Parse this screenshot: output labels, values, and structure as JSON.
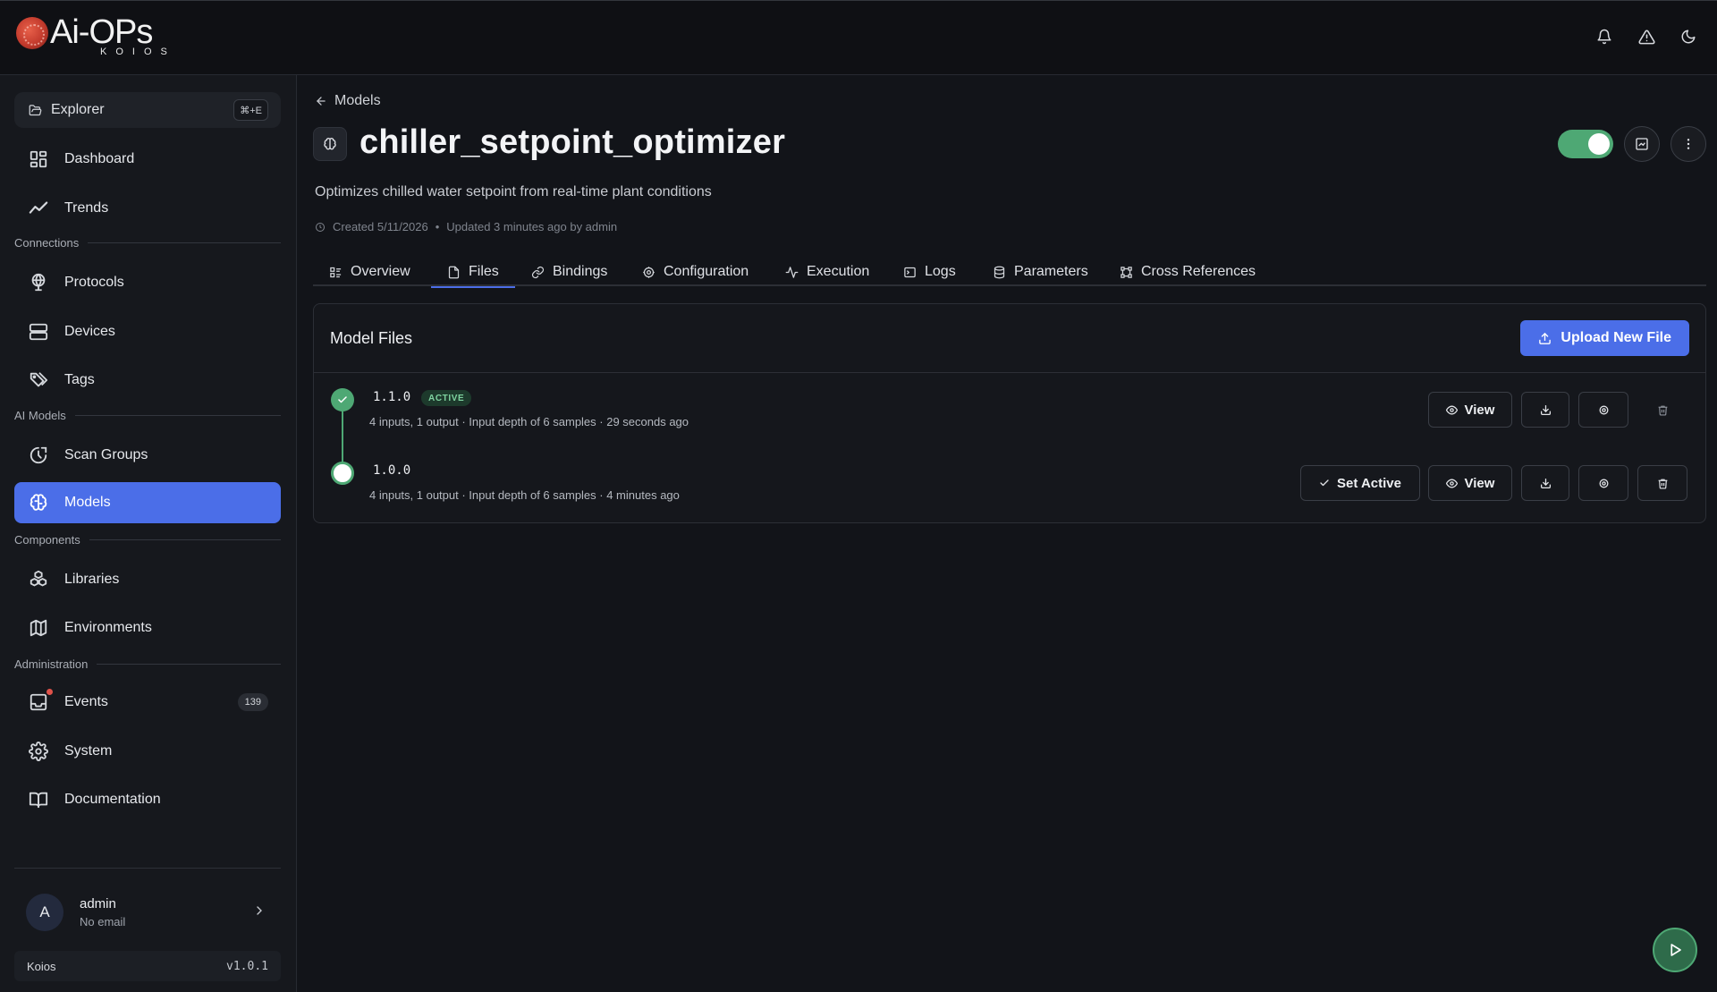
{
  "app": {
    "logo_main": "Ai-OPs",
    "logo_sub": "KOIOS"
  },
  "header": {
    "icons": [
      "bell-icon",
      "alert-triangle-icon",
      "moon-icon"
    ]
  },
  "sidebar": {
    "explorer": {
      "label": "Explorer",
      "shortcut": "⌘+E"
    },
    "items": [
      {
        "label": "Dashboard",
        "icon": "dashboard-icon"
      },
      {
        "label": "Trends",
        "icon": "trends-icon"
      },
      {
        "label": "Protocols",
        "icon": "protocols-icon"
      },
      {
        "label": "Devices",
        "icon": "devices-icon"
      },
      {
        "label": "Tags",
        "icon": "tags-icon"
      },
      {
        "label": "Scan Groups",
        "icon": "scan-groups-icon"
      },
      {
        "label": "Models",
        "icon": "brain-icon",
        "active": true
      },
      {
        "label": "Libraries",
        "icon": "libraries-icon"
      },
      {
        "label": "Environments",
        "icon": "map-icon"
      },
      {
        "label": "Events",
        "icon": "inbox-icon",
        "count": "139"
      },
      {
        "label": "System",
        "icon": "gear-icon"
      },
      {
        "label": "Documentation",
        "icon": "book-icon"
      }
    ],
    "sections": {
      "connections": "Connections",
      "ai_models": "AI Models",
      "components": "Components",
      "administration": "Administration"
    },
    "user": {
      "initial": "A",
      "name": "admin",
      "email": "No email"
    },
    "footer": {
      "name": "Koios",
      "version": "v1.0.1"
    }
  },
  "page": {
    "breadcrumb": "Models",
    "title": "chiller_setpoint_optimizer",
    "description": "Optimizes chilled water setpoint from real-time plant conditions",
    "created": "Created 5/11/2026",
    "separator": "•",
    "updated": "Updated 3 minutes ago by admin",
    "enabled": true,
    "tabs": [
      {
        "label": "Overview",
        "icon": "overview-icon"
      },
      {
        "label": "Files",
        "icon": "file-icon",
        "active": true
      },
      {
        "label": "Bindings",
        "icon": "link-icon"
      },
      {
        "label": "Configuration",
        "icon": "gear-icon"
      },
      {
        "label": "Execution",
        "icon": "activity-icon"
      },
      {
        "label": "Logs",
        "icon": "terminal-icon"
      },
      {
        "label": "Parameters",
        "icon": "database-icon"
      },
      {
        "label": "Cross References",
        "icon": "cross-references-icon"
      }
    ]
  },
  "files": {
    "title": "Model Files",
    "upload_label": "Upload New File",
    "versions": [
      {
        "version": "1.1.0",
        "badge": "ACTIVE",
        "meta": "4 inputs, 1 output · Input depth of 6 samples · 29 seconds ago",
        "view_label": "View"
      },
      {
        "version": "1.0.0",
        "meta": "4 inputs, 1 output · Input depth of 6 samples · 4 minutes ago",
        "set_active_label": "Set Active",
        "view_label": "View"
      }
    ]
  },
  "colors": {
    "accent": "#4b6ee8",
    "success": "#4ea874",
    "background": "#121419"
  }
}
